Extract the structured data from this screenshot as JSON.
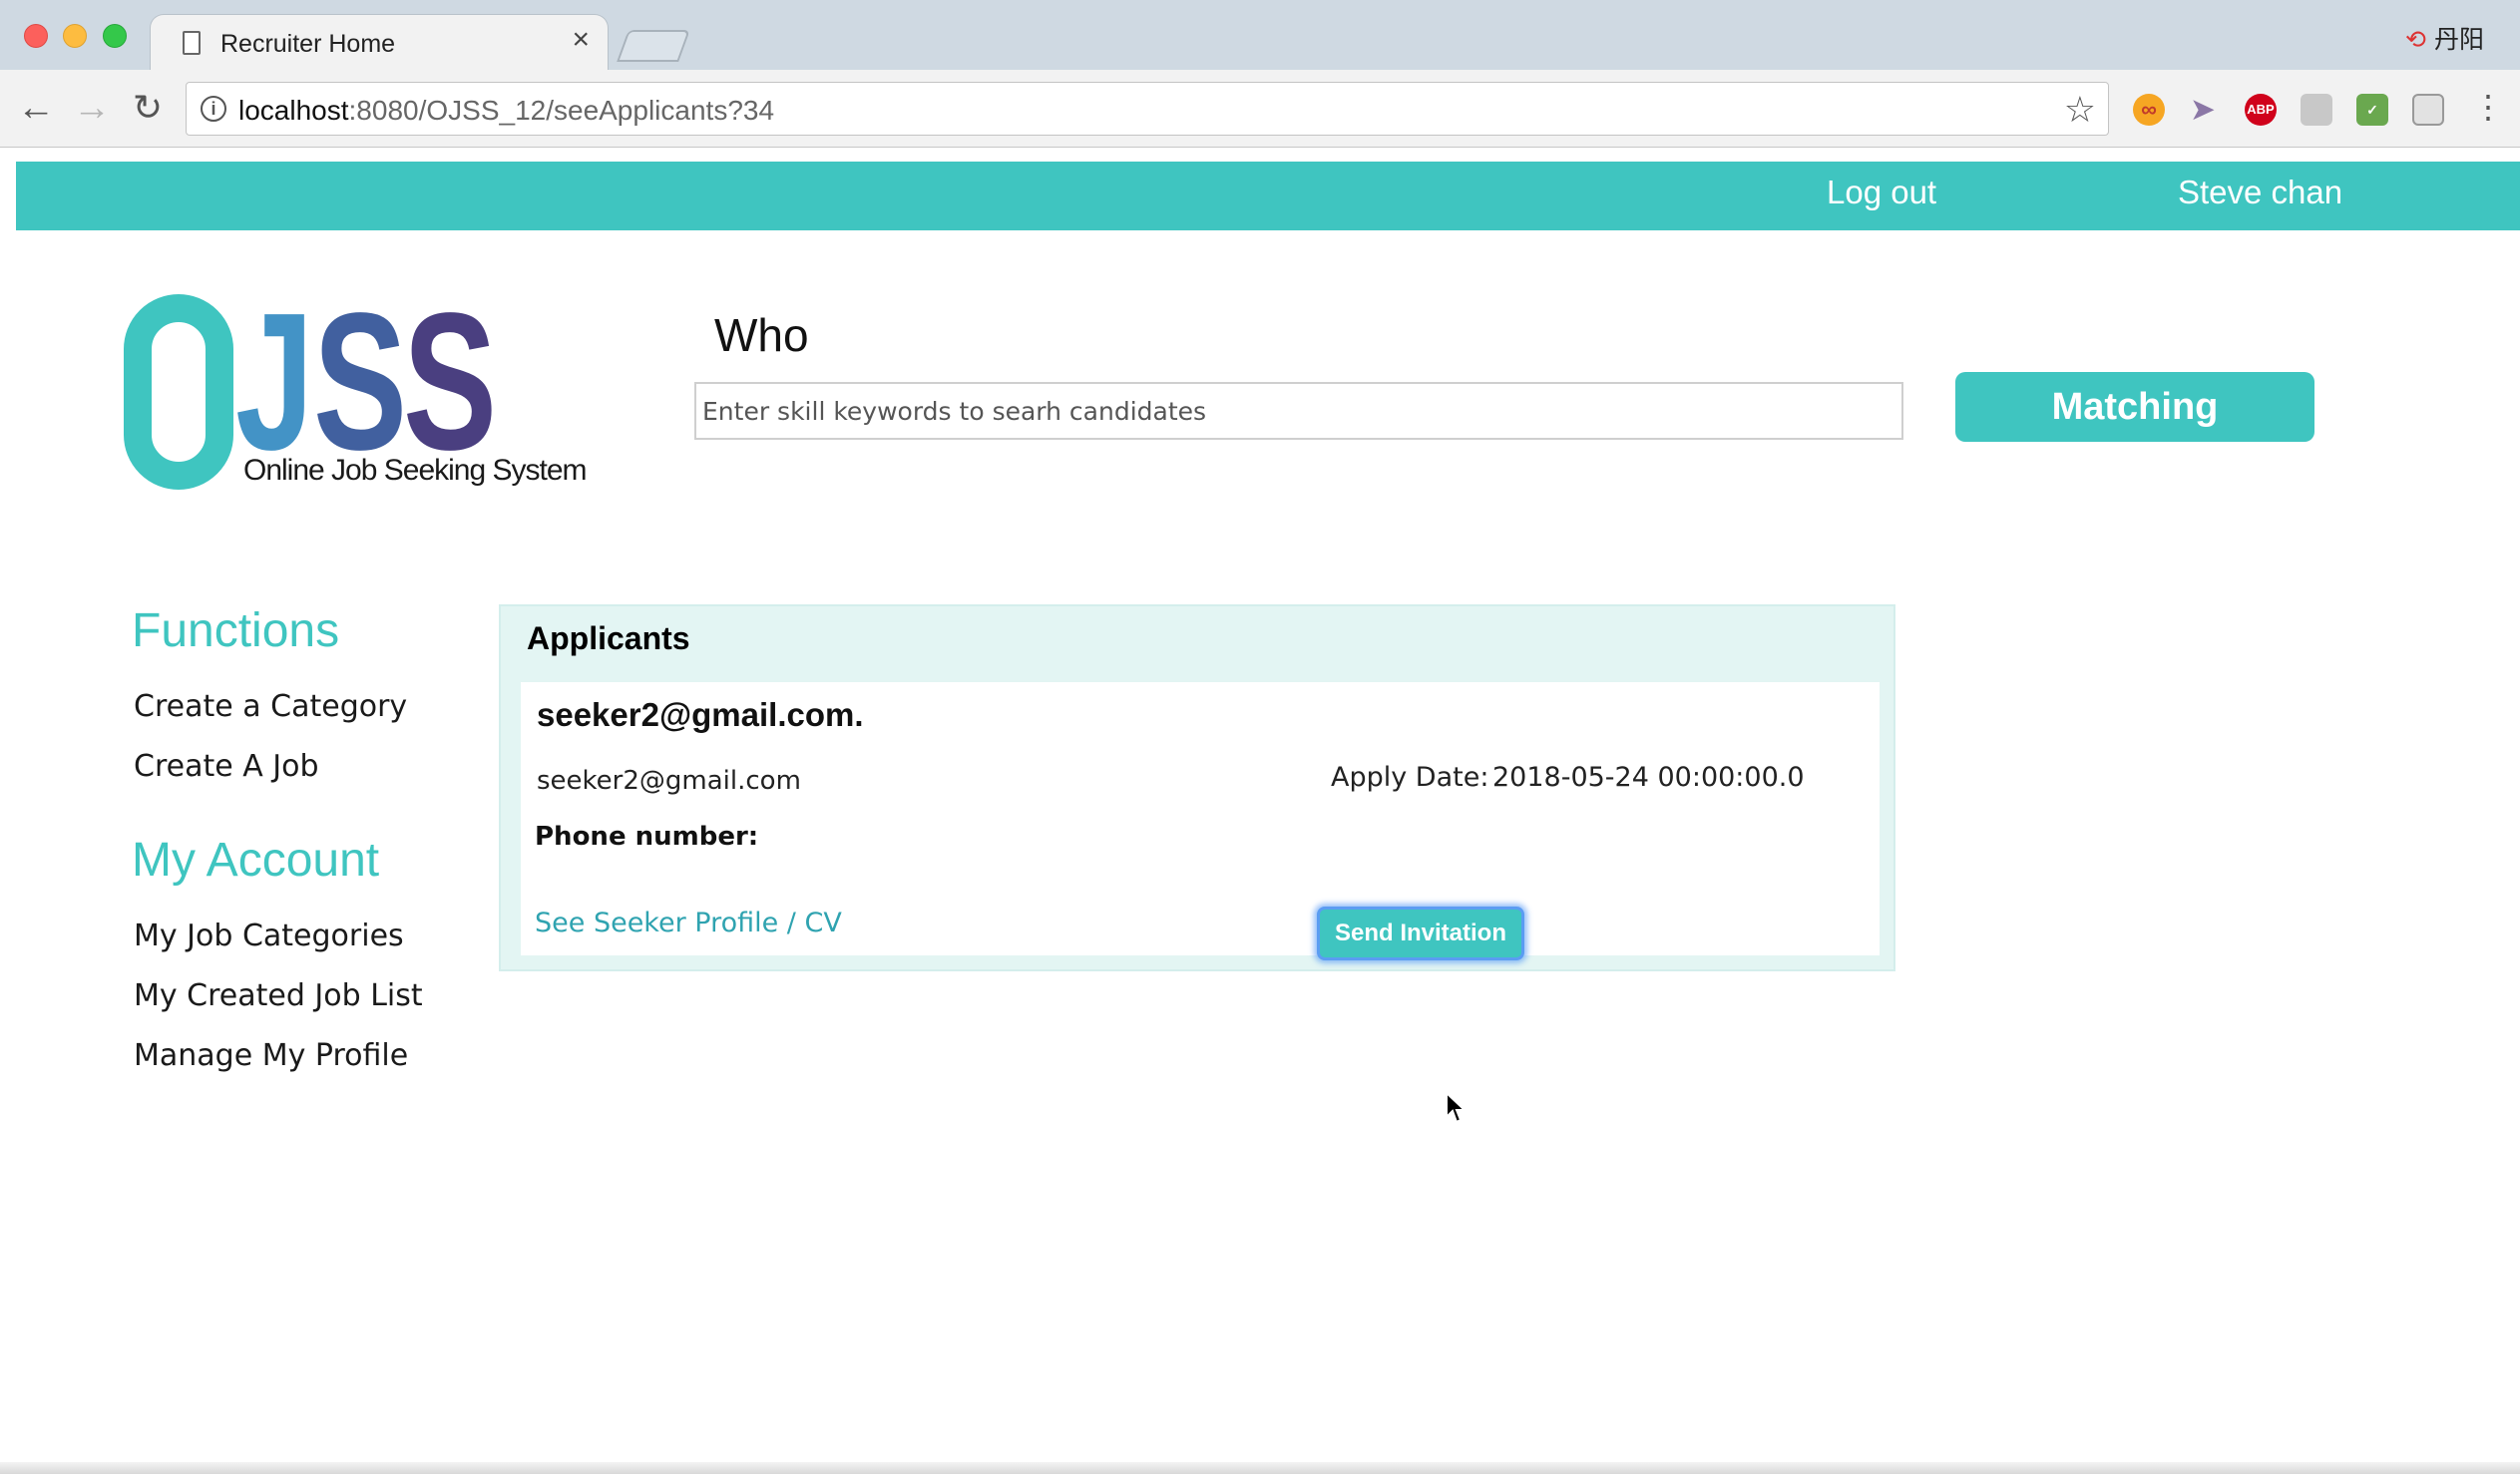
{
  "browser": {
    "tab_title": "Recruiter Home",
    "tab_close": "×",
    "url_host": "localhost",
    "url_rest": ":8080/OJSS_12/seeApplicants?34",
    "user_chip_label": "丹阳",
    "user_chip_icon": "sync-icon",
    "extensions": [
      {
        "name": "infinity-extension-icon",
        "glyph": "∞"
      },
      {
        "name": "cursor-extension-icon",
        "glyph": "➤"
      },
      {
        "name": "adblock-extension-icon",
        "glyph": "ABP"
      },
      {
        "name": "gray-extension-icon",
        "glyph": ""
      },
      {
        "name": "shield-extension-icon",
        "glyph": "✓"
      },
      {
        "name": "cube-extension-icon",
        "glyph": ""
      }
    ]
  },
  "topnav": {
    "logout": "Log out",
    "username": "Steve chan",
    "color": "#3fc5c0"
  },
  "logo": {
    "letter_o": "",
    "letter_j": "J",
    "letter_s1": "S",
    "letter_s2": "S",
    "tagline": "Online Job Seeking System"
  },
  "search": {
    "label": "Who",
    "placeholder": "Enter skill keywords to searh candidates",
    "button": "Matching"
  },
  "sidebar": {
    "functions_heading": "Functions",
    "functions": [
      "Create a Category",
      "Create A Job"
    ],
    "account_heading": "My Account",
    "account": [
      "My Job Categories",
      "My Created Job List",
      "Manage My Profile"
    ]
  },
  "applicants": {
    "title": "Applicants",
    "items": [
      {
        "name": "seeker2@gmail.com.",
        "email": "seeker2@gmail.com",
        "apply_date_label": "Apply Date:",
        "apply_date": "2018-05-24 00:00:00.0",
        "phone_label": "Phone number:",
        "profile_link": "See Seeker Profile / CV",
        "invite_button": "Send Invitation"
      }
    ]
  }
}
